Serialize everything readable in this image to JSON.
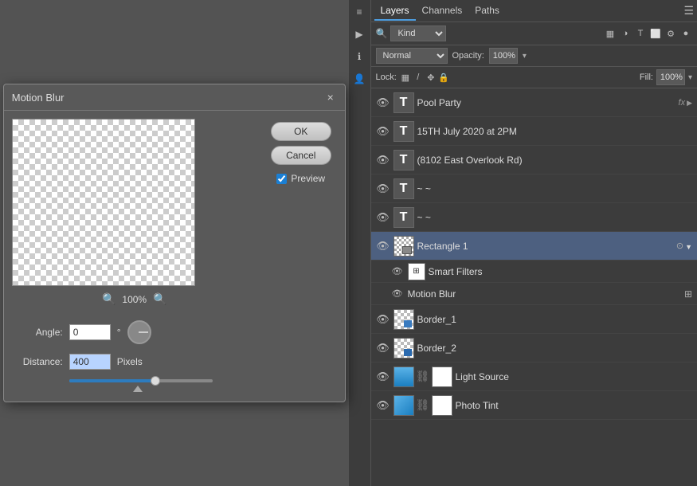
{
  "dialog": {
    "title": "Motion Blur",
    "close_label": "×",
    "ok_label": "OK",
    "cancel_label": "Cancel",
    "preview_label": "Preview",
    "preview_checked": true,
    "zoom_level": "100%",
    "angle_label": "Angle:",
    "angle_value": "0",
    "angle_unit": "°",
    "distance_label": "Distance:",
    "distance_value": "400",
    "distance_unit": "Pixels"
  },
  "layers_panel": {
    "tabs": [
      {
        "label": "Layers",
        "active": true
      },
      {
        "label": "Channels",
        "active": false
      },
      {
        "label": "Paths",
        "active": false
      }
    ],
    "filter_kind": "Kind",
    "blend_mode": "Normal",
    "opacity_label": "Opacity:",
    "opacity_value": "100%",
    "lock_label": "Lock:",
    "fill_label": "Fill:",
    "fill_value": "100%",
    "layers": [
      {
        "id": "pool-party",
        "type": "text",
        "name": "Pool Party",
        "has_fx": true,
        "fx_label": "fx",
        "visible": true,
        "selected": false,
        "indent": 0
      },
      {
        "id": "date-text",
        "type": "text",
        "name": "15TH July 2020 at 2PM",
        "has_fx": false,
        "visible": true,
        "selected": false,
        "indent": 0
      },
      {
        "id": "address-text",
        "type": "text",
        "name": "(8102 East Overlook Rd)",
        "has_fx": false,
        "visible": true,
        "selected": false,
        "indent": 0
      },
      {
        "id": "tilde1",
        "type": "text",
        "name": "~ ~",
        "has_fx": false,
        "visible": true,
        "selected": false,
        "indent": 0
      },
      {
        "id": "tilde2",
        "type": "text",
        "name": "~ ~",
        "has_fx": false,
        "visible": true,
        "selected": false,
        "indent": 0
      },
      {
        "id": "rectangle1",
        "type": "smart",
        "name": "Rectangle 1",
        "has_fx": false,
        "visible": true,
        "selected": true,
        "indent": 0,
        "expanded": true
      },
      {
        "id": "smart-filters",
        "type": "filter-group",
        "name": "Smart Filters",
        "visible": true,
        "selected": false,
        "indent": 1
      },
      {
        "id": "motion-blur-filter",
        "type": "filter",
        "name": "Motion Blur",
        "visible": true,
        "selected": false,
        "indent": 1
      },
      {
        "id": "border1",
        "type": "image",
        "name": "Border_1",
        "visible": true,
        "selected": false,
        "indent": 0
      },
      {
        "id": "border2",
        "type": "image",
        "name": "Border_2",
        "visible": true,
        "selected": false,
        "indent": 0
      },
      {
        "id": "light-source",
        "type": "image-linked",
        "name": "Light Source",
        "visible": true,
        "selected": false,
        "indent": 0
      },
      {
        "id": "photo-tint",
        "type": "image-linked",
        "name": "Photo Tint",
        "visible": true,
        "selected": false,
        "indent": 0
      }
    ]
  }
}
